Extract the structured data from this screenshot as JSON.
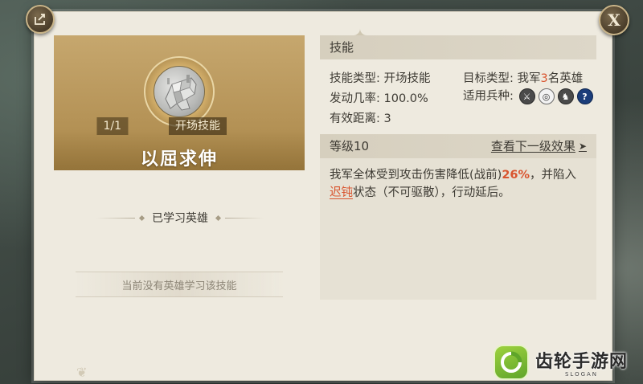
{
  "skill_card": {
    "count": "1/1",
    "type_tag": "开场技能",
    "name": "以屈求伸"
  },
  "learned": {
    "title": "已学习英雄",
    "empty_text": "当前没有英雄学习该技能"
  },
  "skill_info": {
    "header": "技能",
    "skill_type_label": "技能类型:",
    "skill_type_value": "开场技能",
    "target_type_label": "目标类型:",
    "target_prefix": "我军",
    "target_count": "3",
    "target_suffix": "名英雄",
    "trigger_rate_label": "发动几率:",
    "trigger_rate_value": "100.0%",
    "unit_label": "适用兵种:",
    "unit_icons": [
      "sword-icon",
      "bow-target-icon",
      "horse-icon",
      "question-icon"
    ],
    "range_label": "有效距离:",
    "range_value": "3"
  },
  "level": {
    "header": "等级10",
    "next_link": "查看下一级效果",
    "desc_part1": "我军全体受到攻击伤害降低(战前)",
    "desc_pct": "26%",
    "desc_part2": "，并陷入",
    "desc_status": "迟钝",
    "desc_part3": "状态（不可驱散），行动延后。"
  },
  "watermark": {
    "title": "齿轮手游网",
    "sub": "SLOGAN"
  },
  "colors": {
    "accent_red": "#d9542e",
    "card_gold": "#b69458",
    "panel_bg": "#eeeadf"
  }
}
